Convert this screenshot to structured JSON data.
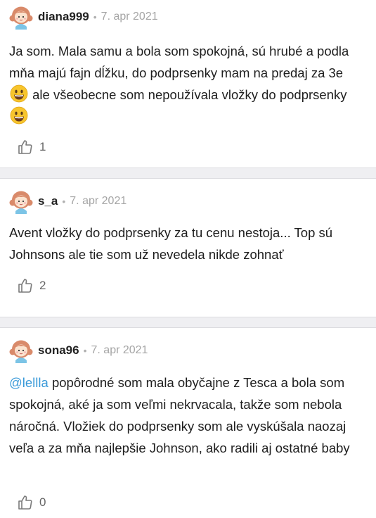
{
  "comments": [
    {
      "username": "diana999",
      "date": "7. apr 2021",
      "text_parts": [
        "Ja som. Mala samu a bola som spokojná, sú hrubé a podla mňa majú fajn dĺžku, do podprsenky mam na predaj za 3e ",
        " ale všeobecne som nepoužívala vložky do podprsenky "
      ],
      "likes": "1"
    },
    {
      "username": "s_a",
      "date": "7. apr 2021",
      "text": "Avent vložky do podprsenky za tu cenu nestoja... Top sú Johnsons ale tie som už nevedela nikde zohnať",
      "likes": "2"
    },
    {
      "username": "sona96",
      "date": "7. apr 2021",
      "mention": "@lellla",
      "text": " popôrodné som mala obyčajne z Tesca a bola som spokojná, aké ja som veľmi nekrvacala, takže som nebola náročná. Vložiek do podprsenky som ale vyskúšala naozaj veľa a za mňa najlepšie Johnson, ako radili aj ostatné baby",
      "likes": "0"
    }
  ],
  "separator": "•",
  "icons": {
    "avatar": "girl-avatar-icon",
    "like": "thumbs-up-icon",
    "emoji": "grinning-face-emoji"
  },
  "colors": {
    "mention": "#3a9ad9",
    "date": "#a5a5a5",
    "separator_bg": "#efeff2"
  }
}
